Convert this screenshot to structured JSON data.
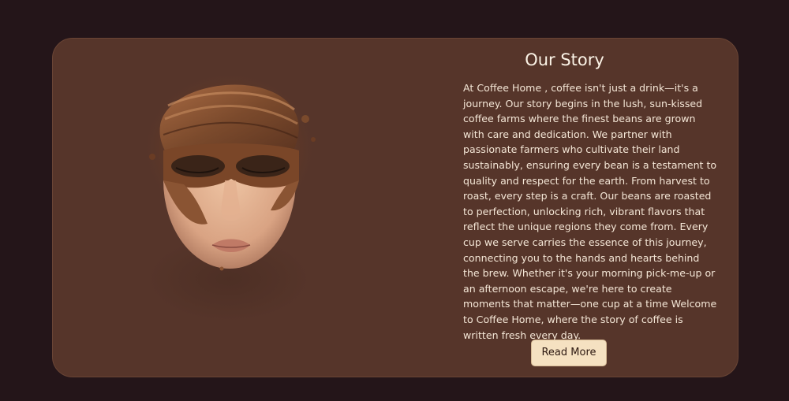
{
  "story_section": {
    "title": "Our Story",
    "body": "At Coffee Home , coffee isn't just a drink—it's a journey. Our story begins in the lush, sun-kissed coffee farms where the finest beans are grown with care and dedication. We partner with passionate farmers who cultivate their land sustainably, ensuring every bean is a testament to quality and respect for the earth. From harvest to roast, every step is a craft. Our beans are roasted to perfection, unlocking rich, vibrant flavors that reflect the unique regions they come from. Every cup we serve carries the essence of this journey, connecting you to the hands and hearts behind the brew. Whether it's your morning pick-me-up or an afternoon escape, we're here to create moments that matter—one cup at a time Welcome to Coffee Home, where the story of coffee is written fresh every day.",
    "read_more_label": "Read More"
  },
  "colors": {
    "page_background": "#241519",
    "card_background": "#56352a",
    "button_background": "#f5e1c1",
    "title_text": "#fbf3e6"
  }
}
